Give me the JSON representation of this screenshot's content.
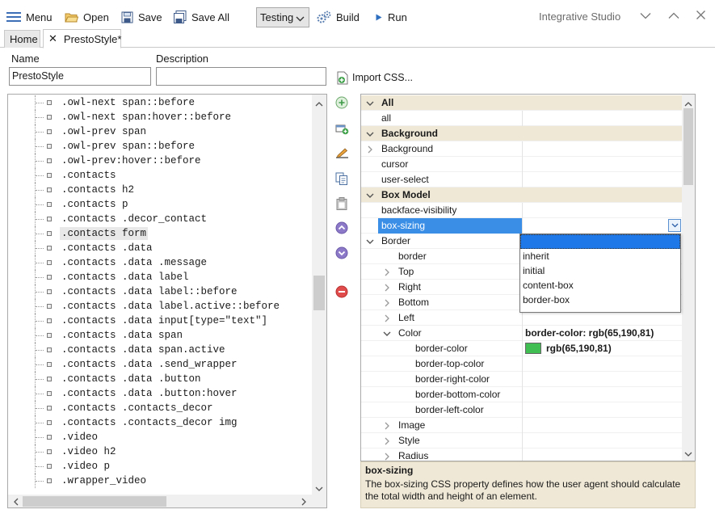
{
  "toolbar": {
    "menu": "Menu",
    "open": "Open",
    "save": "Save",
    "save_all": "Save All",
    "environment": "Testing",
    "build": "Build",
    "run": "Run",
    "app_title": "Integrative Studio"
  },
  "tabs": [
    {
      "label": "Home"
    },
    {
      "label": "PrestoStyle*"
    }
  ],
  "form": {
    "name_label": "Name",
    "name_value": "PrestoStyle",
    "description_label": "Description",
    "description_value": "",
    "import_label": "Import CSS..."
  },
  "tree": {
    "items": [
      ".owl-next span::before",
      ".owl-next span:hover::before",
      ".owl-prev span",
      ".owl-prev span::before",
      ".owl-prev:hover::before",
      ".contacts",
      ".contacts h2",
      ".contacts p",
      ".contacts .decor_contact",
      ".contacts form",
      ".contacts .data",
      ".contacts .data .message",
      ".contacts .data label",
      ".contacts .data label::before",
      ".contacts .data label.active::before",
      ".contacts .data input[type=\"text\"]",
      ".contacts .data span",
      ".contacts .data span.active",
      ".contacts .data .send_wrapper",
      ".contacts .data .button",
      ".contacts .data .button:hover",
      ".contacts .contacts_decor",
      ".contacts .contacts_decor img",
      ".video",
      ".video h2",
      ".video p",
      ".wrapper_video"
    ],
    "selected": ".contacts form"
  },
  "grid": {
    "rows": [
      {
        "kind": "cat",
        "name": "All",
        "level": 0,
        "exp": "open"
      },
      {
        "kind": "prop",
        "name": "all",
        "level": 0,
        "value": ""
      },
      {
        "kind": "cat",
        "name": "Background",
        "level": 0,
        "exp": "open"
      },
      {
        "kind": "prop",
        "name": "Background",
        "level": 0,
        "value": "",
        "exp": "closed"
      },
      {
        "kind": "prop",
        "name": "cursor",
        "level": 0,
        "value": ""
      },
      {
        "kind": "prop",
        "name": "user-select",
        "level": 0,
        "value": ""
      },
      {
        "kind": "cat",
        "name": "Box Model",
        "level": 0,
        "exp": "open"
      },
      {
        "kind": "prop",
        "name": "backface-visibility",
        "level": 0,
        "value": ""
      },
      {
        "kind": "prop",
        "name": "box-sizing",
        "level": 0,
        "value": "",
        "selected": true
      },
      {
        "kind": "prop",
        "name": "Border",
        "level": 0,
        "value": "",
        "exp": "open"
      },
      {
        "kind": "prop",
        "name": "border",
        "level": 1,
        "value": ""
      },
      {
        "kind": "prop",
        "name": "Top",
        "level": 1,
        "value": "",
        "exp": "closed"
      },
      {
        "kind": "prop",
        "name": "Right",
        "level": 1,
        "value": "",
        "exp": "closed"
      },
      {
        "kind": "prop",
        "name": "Bottom",
        "level": 1,
        "value": "",
        "exp": "closed"
      },
      {
        "kind": "prop",
        "name": "Left",
        "level": 1,
        "value": "",
        "exp": "closed"
      },
      {
        "kind": "prop",
        "name": "Color",
        "level": 1,
        "value": "border-color: rgb(65,190,81)",
        "exp": "open",
        "bold": true
      },
      {
        "kind": "prop",
        "name": "border-color",
        "level": 2,
        "value": "rgb(65,190,81)",
        "swatch": "#41be51",
        "bold": true
      },
      {
        "kind": "prop",
        "name": "border-top-color",
        "level": 2,
        "value": ""
      },
      {
        "kind": "prop",
        "name": "border-right-color",
        "level": 2,
        "value": ""
      },
      {
        "kind": "prop",
        "name": "border-bottom-color",
        "level": 2,
        "value": ""
      },
      {
        "kind": "prop",
        "name": "border-left-color",
        "level": 2,
        "value": ""
      },
      {
        "kind": "prop",
        "name": "Image",
        "level": 1,
        "value": "",
        "exp": "closed"
      },
      {
        "kind": "prop",
        "name": "Style",
        "level": 1,
        "value": "",
        "exp": "closed"
      },
      {
        "kind": "prop",
        "name": "Radius",
        "level": 1,
        "value": "",
        "exp": "closed"
      }
    ],
    "dropdown_options": [
      "",
      "inherit",
      "initial",
      "content-box",
      "border-box"
    ]
  },
  "description": {
    "title": "box-sizing",
    "text": "The box-sizing CSS property defines how the user agent should calculate the total width and height of an element."
  },
  "colors": {
    "accent": "#3a8ee6",
    "category_bg": "#efe8d6",
    "swatch_green": "#41be51"
  }
}
